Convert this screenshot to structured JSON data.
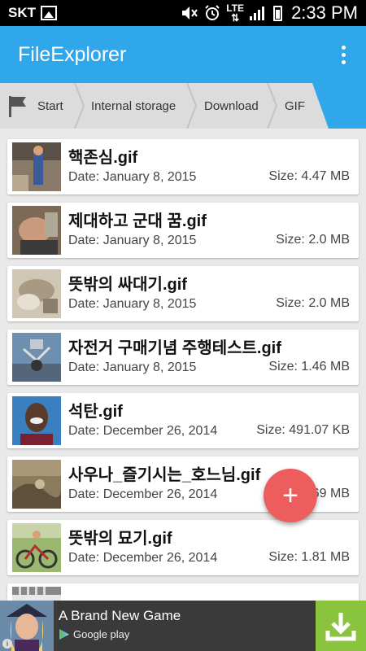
{
  "status_bar": {
    "carrier": "SKT",
    "lte": "LTE",
    "time": "2:33 PM",
    "icons": [
      "gallery-icon",
      "mute-icon",
      "alarm-icon",
      "lte-icon",
      "signal-icon",
      "battery-icon"
    ]
  },
  "app_bar": {
    "title": "FileExplorer",
    "menu_icon": "more-vert-icon"
  },
  "breadcrumb": {
    "items": [
      "Start",
      "Internal storage",
      "Download",
      "GIF"
    ],
    "accent": "#2fa7ea"
  },
  "files": [
    {
      "name": "핵존심.gif",
      "date": "Date: January 8, 2015",
      "size": "Size: 4.47 MB"
    },
    {
      "name": "제대하고 군대 꿈.gif",
      "date": "Date: January 8, 2015",
      "size": "Size: 2.0 MB"
    },
    {
      "name": "뜻밖의 싸대기.gif",
      "date": "Date: January 8, 2015",
      "size": "Size: 2.0 MB"
    },
    {
      "name": "자전거 구매기념 주행테스트.gif",
      "date": "Date: January 8, 2015",
      "size": "Size: 1.46 MB"
    },
    {
      "name": "석탄.gif",
      "date": "Date: December 26, 2014",
      "size": "Size: 491.07 KB"
    },
    {
      "name": "사우나_즐기시는_호느님.gif",
      "date": "Date: December 26, 2014",
      "size": "Size: 1.69 MB"
    },
    {
      "name": "뜻밖의 묘기.gif",
      "date": "Date: December 26, 2014",
      "size": "Size: 1.81 MB"
    },
    {
      "name": "",
      "date": "",
      "size": ""
    }
  ],
  "fab": {
    "label": "+",
    "color": "#ee5d5d"
  },
  "ad": {
    "title": "A Brand New Game",
    "store": "Google play",
    "info": "i",
    "download_color": "#8ac43f"
  },
  "colors": {
    "primary": "#2fa7ea",
    "background": "#e9e9e9"
  }
}
